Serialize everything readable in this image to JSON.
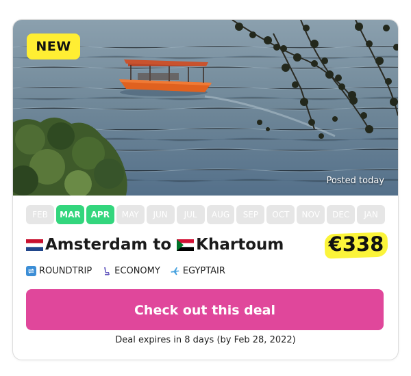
{
  "deal": {
    "badge": "NEW",
    "posted": "Posted today",
    "months": [
      {
        "label": "FEB",
        "active": false
      },
      {
        "label": "MAR",
        "active": true
      },
      {
        "label": "APR",
        "active": true
      },
      {
        "label": "MAY",
        "active": false
      },
      {
        "label": "JUN",
        "active": false
      },
      {
        "label": "JUL",
        "active": false
      },
      {
        "label": "AUG",
        "active": false
      },
      {
        "label": "SEP",
        "active": false
      },
      {
        "label": "OCT",
        "active": false
      },
      {
        "label": "NOV",
        "active": false
      },
      {
        "label": "DEC",
        "active": false
      },
      {
        "label": "JAN",
        "active": false
      }
    ],
    "origin": "Amsterdam",
    "connector": " to ",
    "destination": "Khartoum",
    "origin_flag": "netherlands-flag",
    "destination_flag": "sudan-flag",
    "price": "€338",
    "trip_type": "ROUNDTRIP",
    "cabin": "ECONOMY",
    "airline": "EGYPTAIR",
    "cta_label": "Check out this deal",
    "expires": "Deal expires in 8 days (by Feb 28, 2022)"
  },
  "colors": {
    "badge": "#ffee33",
    "month_active": "#33d67d",
    "month_inactive": "#e6e6e6",
    "price_highlight": "#fbf43a",
    "cta": "#e0479b"
  }
}
